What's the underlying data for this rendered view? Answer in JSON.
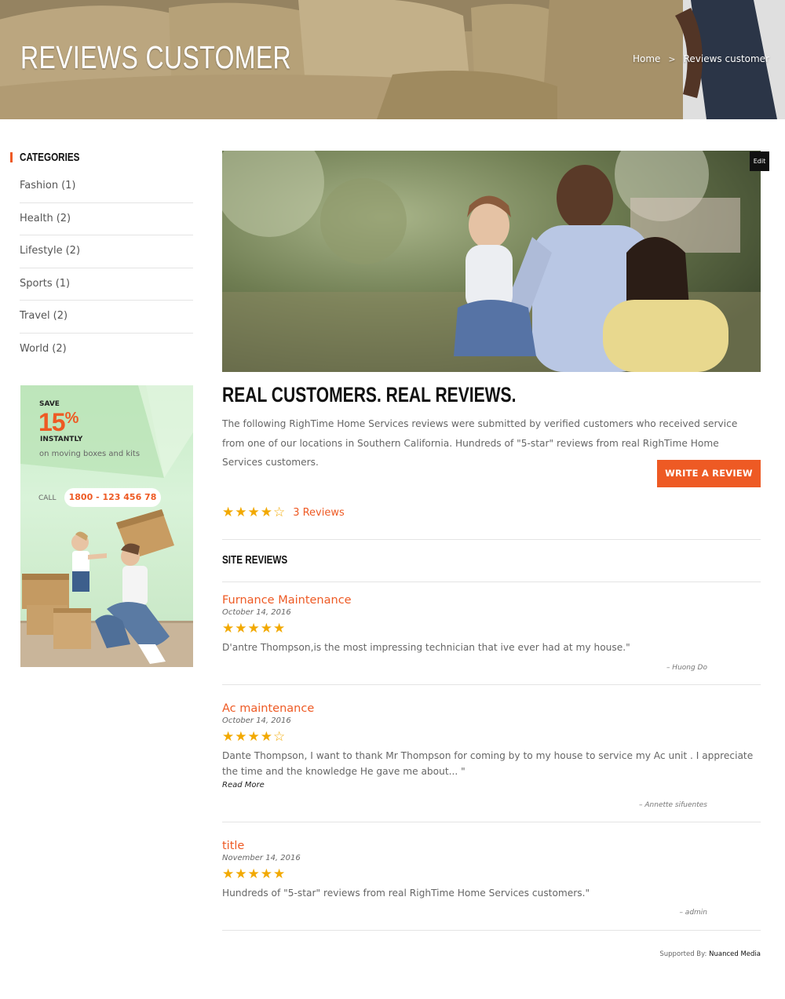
{
  "hero": {
    "title": "REVIEWS CUSTOMER",
    "breadcrumb": {
      "home": "Home",
      "separator": ">",
      "current": "Reviews customer"
    }
  },
  "sidebar": {
    "heading": "CATEGORIES",
    "categories": [
      {
        "name": "Fashion",
        "count": "(1)"
      },
      {
        "name": "Health",
        "count": "(2)"
      },
      {
        "name": "Lifestyle",
        "count": "(2)"
      },
      {
        "name": "Sports",
        "count": "(1)"
      },
      {
        "name": "Travel",
        "count": "(2)"
      },
      {
        "name": "World",
        "count": "(2)"
      }
    ],
    "ad": {
      "save": "SAVE",
      "percent": "15",
      "percent_sign": "%",
      "instantly": "INSTANTLY",
      "subtitle": "on moving boxes and kits",
      "call_label": "CALL",
      "phone": "1800 - 123 456 78"
    }
  },
  "main": {
    "edit_label": "Edit",
    "title": "REAL CUSTOMERS. REAL REVIEWS.",
    "intro": "The following RighTime Home Services reviews were submitted by verified customers who received service from one of our locations in Southern California. Hundreds of \"5-star\" reviews from real RighTime Home Services customers.",
    "write_button": "WRITE A REVIEW",
    "summary": {
      "stars": "★★★★☆",
      "rating": 4,
      "count_label": "3 Reviews"
    },
    "site_reviews_heading": "SITE REVIEWS",
    "reviews": [
      {
        "title": "Furnance Maintenance",
        "date": "October 14, 2016",
        "stars": "★★★★★",
        "rating": 5,
        "body": "D'antre Thompson,is the most impressing technician that ive ever had at my house.\"",
        "more": "",
        "author": "– Huong Do"
      },
      {
        "title": "Ac maintenance",
        "date": "October 14, 2016",
        "stars": "★★★★☆",
        "rating": 4,
        "body": "Dante Thompson, I want to thank Mr Thompson for coming by to my house to service my Ac unit . I appreciate the time and the knowledge He gave me about... \"",
        "more": "Read More",
        "author": "– Annette sifuentes"
      },
      {
        "title": "title",
        "date": "November 14, 2016",
        "stars": "★★★★★",
        "rating": 5,
        "body": "Hundreds of \"5-star\" reviews from real RighTime Home Services customers.\"",
        "more": "",
        "author": "– admin"
      }
    ]
  },
  "footer": {
    "supported_by": "Supported By:",
    "brand": "Nuanced Media"
  },
  "colors": {
    "accent": "#ee5a24",
    "star": "#f2a900",
    "heading": "#111111",
    "text": "#666666"
  }
}
